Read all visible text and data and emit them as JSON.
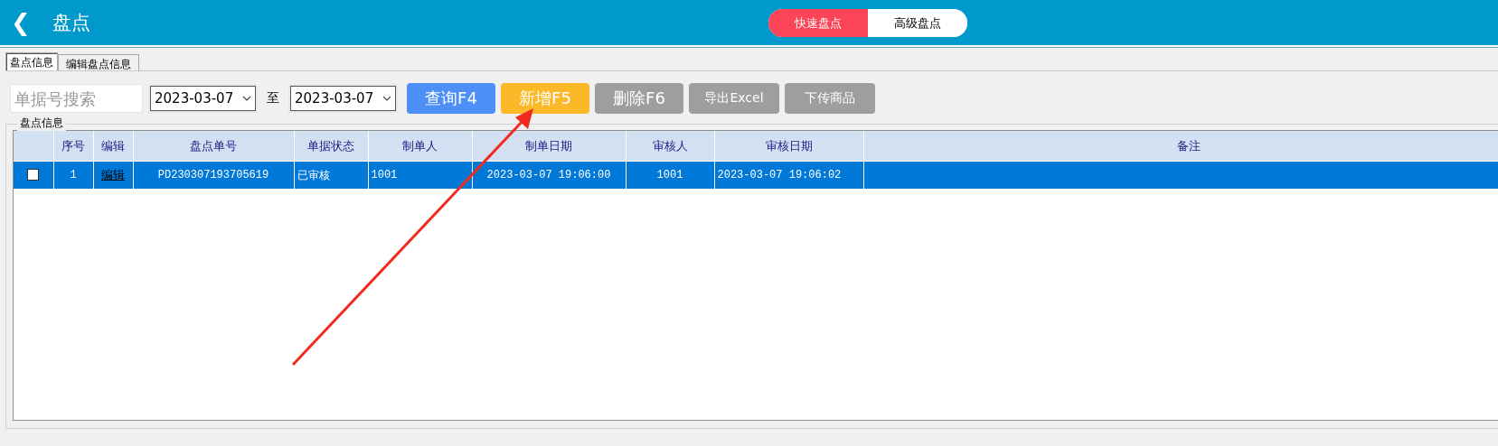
{
  "header": {
    "back": "❮",
    "title": "盘点",
    "modes": [
      {
        "label": "快速盘点",
        "selected": true
      },
      {
        "label": "高级盘点",
        "selected": false
      }
    ]
  },
  "tabs": [
    {
      "label": "盘点信息",
      "selected": true
    },
    {
      "label": "编辑盘点信息",
      "selected": false
    }
  ],
  "toolbar": {
    "search": {
      "placeholder": "单据号搜索"
    },
    "date_from": "2023-03-07",
    "separator": "至",
    "date_to": "2023-03-07",
    "buttons": [
      {
        "label": "查询F4",
        "color": "#4e8ef7",
        "kind": "large"
      },
      {
        "label": "新增F5",
        "color": "#fbb829",
        "kind": "large"
      },
      {
        "label": "删除F6",
        "color": "#9e9e9e",
        "kind": "large"
      },
      {
        "label": "导出Excel",
        "color": "#9e9e9e",
        "kind": "small"
      },
      {
        "label": "下传商品",
        "color": "#9e9e9e",
        "kind": "small"
      }
    ]
  },
  "group": {
    "title": "盘点信息"
  },
  "table": {
    "columns": [
      "",
      "序号",
      "编辑",
      "盘点单号",
      "单据状态",
      "制单人",
      "制单日期",
      "审核人",
      "审核日期",
      "备注"
    ],
    "rows": [
      {
        "selected": true,
        "checked": false,
        "cells": [
          "",
          "1",
          "编辑",
          "PD230307193705619",
          "已审核",
          "1001",
          "2023-03-07 19:06:00",
          "1001",
          "2023-03-07 19:06:02",
          ""
        ]
      }
    ]
  }
}
